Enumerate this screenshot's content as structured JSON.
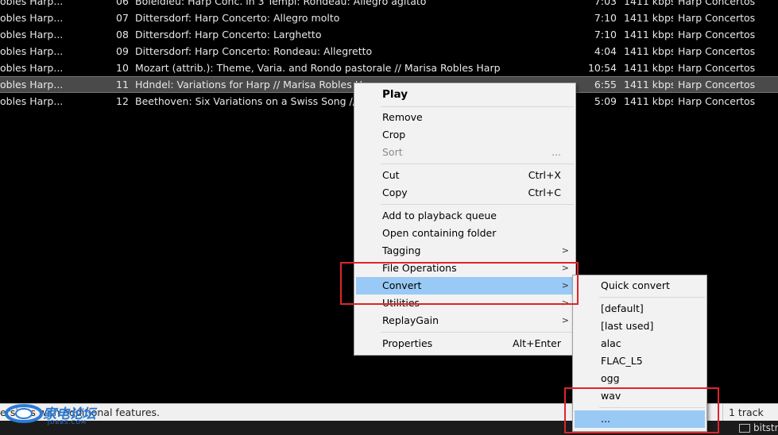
{
  "playlist": {
    "rows": [
      {
        "artist": "obles Harp...",
        "num": "06",
        "title": "Boieldieu: Harp Conc. in 3 Tempi: Rondeau: Allegro agitato",
        "duration": "7:03",
        "bitrate": "1411 kbps",
        "album": "Harp Concertos"
      },
      {
        "artist": "obles Harp...",
        "num": "07",
        "title": "Dittersdorf: Harp Concerto: Allegro molto",
        "duration": "7:10",
        "bitrate": "1411 kbps",
        "album": "Harp Concertos"
      },
      {
        "artist": "obles Harp...",
        "num": "08",
        "title": "Dittersdorf: Harp Concerto: Larghetto",
        "duration": "7:10",
        "bitrate": "1411 kbps",
        "album": "Harp Concertos"
      },
      {
        "artist": "obles Harp...",
        "num": "09",
        "title": "Dittersdorf: Harp Concerto: Rondeau: Allegretto",
        "duration": "4:04",
        "bitrate": "1411 kbps",
        "album": "Harp Concertos"
      },
      {
        "artist": "obles Harp...",
        "num": "10",
        "title": "Mozart (attrib.): Theme, Varia. and Rondo pastorale // Marisa Robles Harp",
        "duration": "10:54",
        "bitrate": "1411 kbps",
        "album": "Harp Concertos"
      },
      {
        "artist": "obles Harp...",
        "num": "11",
        "title": "Hdndel: Variations for Harp // Marisa Robles H",
        "duration": "6:55",
        "bitrate": "1411 kbps",
        "album": "Harp Concertos"
      },
      {
        "artist": "obles Harp...",
        "num": "12",
        "title": "Beethoven: Six Variations on a Swiss Song // M",
        "duration": "5:09",
        "bitrate": "1411 kbps",
        "album": "Harp Concertos"
      }
    ]
  },
  "context_menu": {
    "play": "Play",
    "remove": "Remove",
    "crop": "Crop",
    "sort": "Sort",
    "sort_more": "...",
    "cut": "Cut",
    "cut_shortcut": "Ctrl+X",
    "copy": "Copy",
    "copy_shortcut": "Ctrl+C",
    "add_queue": "Add to playback queue",
    "open_folder": "Open containing folder",
    "tagging": "Tagging",
    "file_operations": "File Operations",
    "convert": "Convert",
    "utilities": "Utilities",
    "replaygain": "ReplayGain",
    "properties": "Properties",
    "properties_shortcut": "Alt+Enter",
    "submenu_arrow": ">"
  },
  "convert_submenu": {
    "quick_convert": "Quick convert",
    "default": "[default]",
    "last_used": "[last used]",
    "alac": "alac",
    "flac": "FLAC_L5",
    "ogg": "ogg",
    "wav": "wav",
    "more": "..."
  },
  "status": {
    "text": "ersions with additional features.",
    "tracks": "1 track",
    "bitstream": "bitstr"
  },
  "watermark": {
    "logo_text": "家电论坛",
    "logo_sub": "JDBBS.COM"
  },
  "colors": {
    "highlight": "#99c9f5",
    "annotation": "#e0242c",
    "selected_row": "#4a4a4a"
  }
}
